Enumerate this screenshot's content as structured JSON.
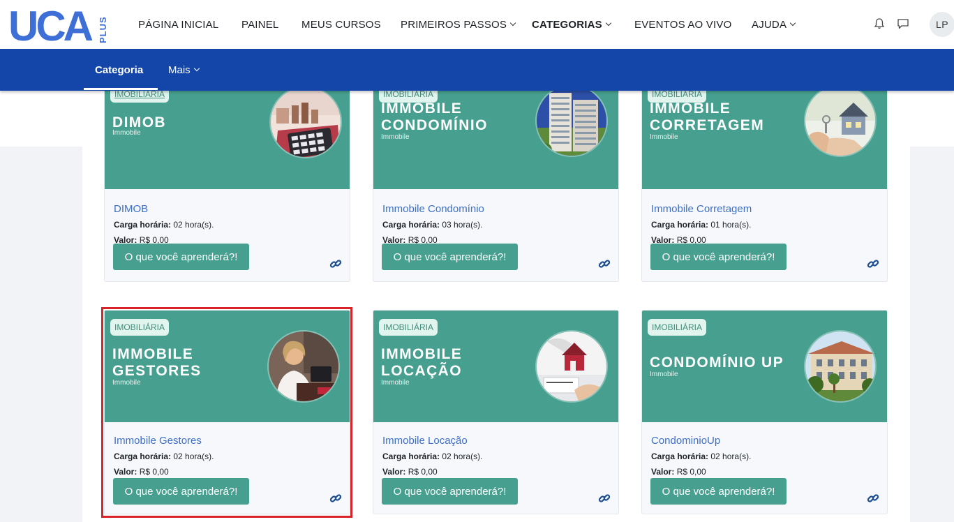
{
  "header": {
    "logo_text": "UCA",
    "logo_suffix": "PLUS",
    "nav": [
      {
        "label": "PÁGINA INICIAL",
        "dropdown": false,
        "active": false
      },
      {
        "label": "PAINEL",
        "dropdown": false,
        "active": false
      },
      {
        "label": "MEUS CURSOS",
        "dropdown": false,
        "active": false
      },
      {
        "label": "PRIMEIROS PASSOS",
        "dropdown": true,
        "active": false
      },
      {
        "label": "CATEGORIAS",
        "dropdown": true,
        "active": true
      },
      {
        "label": "EVENTOS AO VIVO",
        "dropdown": false,
        "active": false
      },
      {
        "label": "AJUDA",
        "dropdown": true,
        "active": false
      }
    ],
    "icons": [
      "bell-icon",
      "chat-icon"
    ],
    "avatar_initials": "LP"
  },
  "subnav": {
    "tabs": [
      {
        "label": "Categoria",
        "active": true
      },
      {
        "label": "Mais",
        "dropdown": true
      }
    ]
  },
  "colors": {
    "brand_blue": "#1346a8",
    "logo_blue": "#3d6fd6",
    "card_green": "#47a08f",
    "link_blue": "#3d6fc6",
    "highlight_red": "#d8232a"
  },
  "cards": [
    {
      "tag": "IMOBILIARIA",
      "banner_title": "DIMOB",
      "banner_sub": "Immobile",
      "photo": "calculator-photo-icon",
      "title": "DIMOB",
      "hours_label": "Carga horária:",
      "hours_value": "02 hora(s).",
      "price_label": "Valor:",
      "price_value": "R$ 0,00",
      "button": "O que você aprenderá?!",
      "highlighted": false
    },
    {
      "tag": "IMOBILIARIA",
      "banner_title": "IMMOBILE\nCONDOMÍNIO",
      "banner_sub": "Immobile",
      "photo": "building-photo-icon",
      "title": "Immobile Condomínio",
      "hours_label": "Carga horária:",
      "hours_value": "03 hora(s).",
      "price_label": "Valor:",
      "price_value": "R$ 0,00",
      "button": "O que você aprenderá?!",
      "highlighted": false
    },
    {
      "tag": "IMOBILIARIA",
      "banner_title": "IMMOBILE\nCORRETAGEM",
      "banner_sub": "Immobile",
      "photo": "house-keys-photo-icon",
      "title": "Immobile Corretagem",
      "hours_label": "Carga horária:",
      "hours_value": "01 hora(s).",
      "price_label": "Valor:",
      "price_value": "R$ 0,00",
      "button": "O que você aprenderá?!",
      "highlighted": false
    },
    {
      "tag": "IMOBILIÁRIA",
      "banner_title": "IMMOBILE\nGESTORES",
      "banner_sub": "Immobile",
      "photo": "manager-photo-icon",
      "title": "Immobile Gestores",
      "hours_label": "Carga horária:",
      "hours_value": "02 hora(s).",
      "price_label": "Valor:",
      "price_value": "R$ 0,00",
      "button": "O que você aprenderá?!",
      "highlighted": true
    },
    {
      "tag": "IMOBILIÁRIA",
      "banner_title": "IMMOBILE\nLOCAÇÃO",
      "banner_sub": "Immobile",
      "photo": "contract-house-photo-icon",
      "title": "Immobile Locação",
      "hours_label": "Carga horária:",
      "hours_value": "02 hora(s).",
      "price_label": "Valor:",
      "price_value": "R$ 0,00",
      "button": "O que você aprenderá?!",
      "highlighted": false
    },
    {
      "tag": "IMOBILIÁRIA",
      "banner_title": "CONDOMÍNIO UP",
      "banner_sub": "Immobile",
      "photo": "condo-photo-icon",
      "title": "CondominioUp",
      "hours_label": "Carga horária:",
      "hours_value": "02 hora(s).",
      "price_label": "Valor:",
      "price_value": "R$ 0,00",
      "button": "O que você aprenderá?!",
      "highlighted": false
    }
  ]
}
